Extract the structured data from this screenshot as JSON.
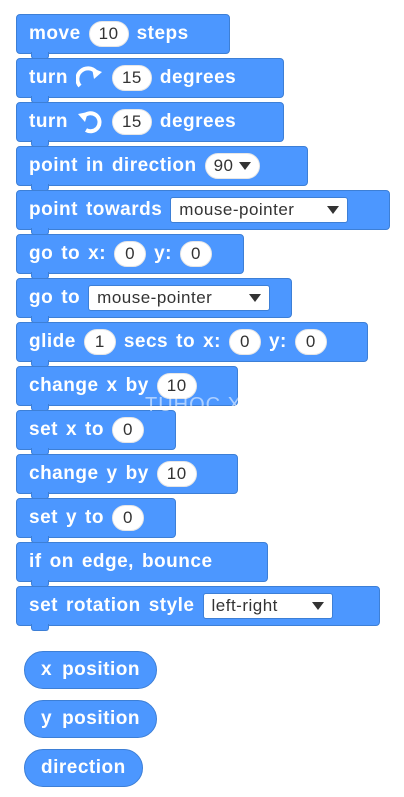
{
  "blocks": {
    "move": {
      "w1": "move",
      "steps": "10",
      "w2": "steps"
    },
    "turn_cw": {
      "w1": "turn",
      "deg": "15",
      "w2": "degrees"
    },
    "turn_ccw": {
      "w1": "turn",
      "deg": "15",
      "w2": "degrees"
    },
    "point_dir": {
      "w1": "point",
      "w2": "in",
      "w3": "direction",
      "val": "90"
    },
    "point_towards": {
      "w1": "point",
      "w2": "towards",
      "val": "mouse-pointer"
    },
    "goto_xy": {
      "w1": "go",
      "w2": "to",
      "w3": "x:",
      "x": "0",
      "w4": "y:",
      "y": "0"
    },
    "goto": {
      "w1": "go",
      "w2": "to",
      "val": "mouse-pointer"
    },
    "glide": {
      "w1": "glide",
      "secs": "1",
      "w2": "secs",
      "w3": "to",
      "w4": "x:",
      "x": "0",
      "w5": "y:",
      "y": "0"
    },
    "change_x": {
      "w1": "change",
      "w2": "x",
      "w3": "by",
      "val": "10"
    },
    "set_x": {
      "w1": "set",
      "w2": "x",
      "w3": "to",
      "val": "0"
    },
    "change_y": {
      "w1": "change",
      "w2": "y",
      "w3": "by",
      "val": "10"
    },
    "set_y": {
      "w1": "set",
      "w2": "y",
      "w3": "to",
      "val": "0"
    },
    "bounce": {
      "w1": "if",
      "w2": "on",
      "w3": "edge,",
      "w4": "bounce"
    },
    "rotation": {
      "w1": "set",
      "w2": "rotation",
      "w3": "style",
      "val": "left-right"
    }
  },
  "reporters": {
    "x_position": [
      "x",
      "position"
    ],
    "y_position": [
      "y",
      "position"
    ],
    "direction": [
      "direction"
    ]
  },
  "watermark": "TUHOC.XYZ",
  "colors": {
    "block": "#4c97ff",
    "border": "#3d7fd6",
    "field": "#ffffff"
  },
  "icons": {
    "turn_cw": "rotate-clockwise-icon",
    "turn_ccw": "rotate-counterclockwise-icon",
    "dropdown": "dropdown-caret-icon"
  }
}
